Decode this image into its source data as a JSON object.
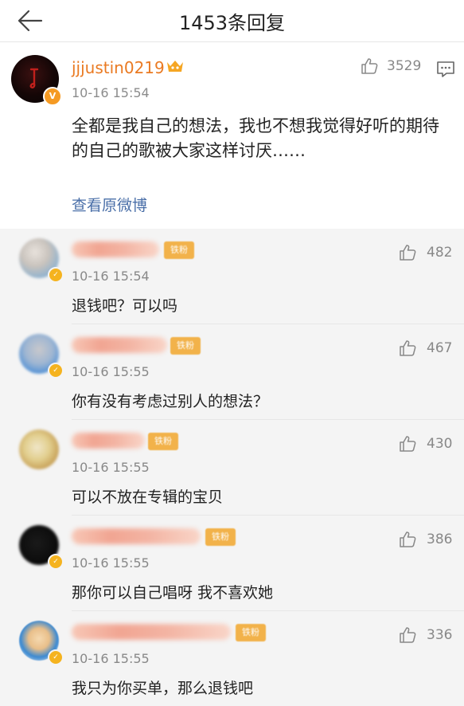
{
  "header": {
    "title": "1453条回复"
  },
  "main_post": {
    "username": "jjjustin0219",
    "time": "10-16 15:54",
    "like_count": "3529",
    "text": "全都是我自己的想法，我也不想我觉得好听的期待的自己的歌被大家这样讨厌……",
    "view_original": "查看原微博",
    "verified_badge": "V"
  },
  "replies": [
    {
      "fan_tag": "铁粉",
      "time": "10-16 15:54",
      "text": "退钱吧？可以吗",
      "like_count": "482"
    },
    {
      "fan_tag": "铁粉",
      "time": "10-16 15:55",
      "text": "你有没有考虑过别人的想法？",
      "like_count": "467"
    },
    {
      "fan_tag": "铁粉",
      "time": "10-16 15:55",
      "text": "可以不放在专辑的宝贝",
      "like_count": "430"
    },
    {
      "fan_tag": "铁粉",
      "time": "10-16 15:55",
      "text": "那你可以自己唱呀 我不喜欢她",
      "like_count": "386"
    },
    {
      "fan_tag": "铁粉",
      "time": "10-16 15:55",
      "text": "我只为你买单，那么退钱吧",
      "like_count": "336"
    }
  ],
  "colors": {
    "username": "#ea7a22",
    "link": "#4a6fa8",
    "fan_tag": "#f2b24a",
    "verified_badge": "#f59a23"
  },
  "icons": [
    "back-arrow-icon",
    "crown-icon",
    "like-icon",
    "comment-icon",
    "verified-badge-icon"
  ]
}
